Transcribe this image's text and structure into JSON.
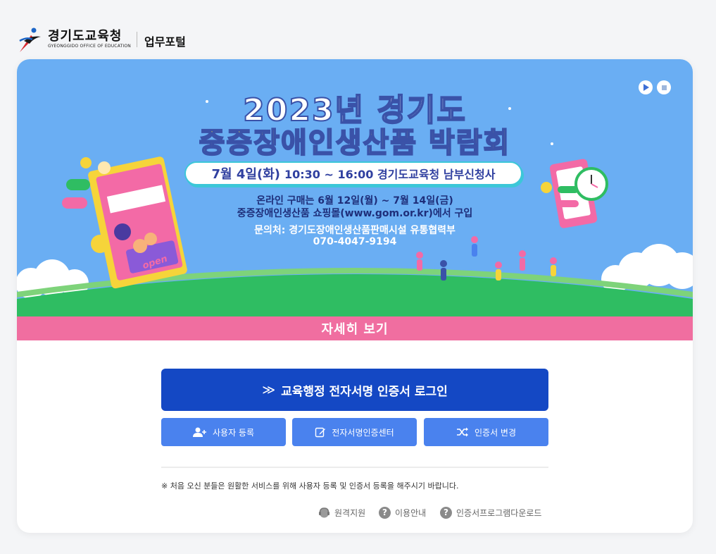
{
  "header": {
    "org_name": "경기도교육청",
    "org_name_en": "GYEONGGIDO OFFICE OF EDUCATION",
    "portal_label": "업무포털"
  },
  "banner": {
    "title_line1": "2023년 경기도",
    "title_line2": "중증장애인생산품 박람회",
    "date_text": "7월 4일(화)",
    "time_place": "10:30 ~ 16:00  경기도교육청 남부신청사",
    "info1": "온라인 구매는 6월 12일(월) ~ 7월 14일(금)",
    "info2": "중증장애인생산품 쇼핑몰(www.gom.or.kr)에서 구입",
    "info3": "문의처: 경기도장애인생산품판매시설 유통협력부",
    "info4": "070-4047-9194",
    "open_sign": "open",
    "detail_label": "자세히 보기",
    "colors": {
      "sky": "#6aaef3",
      "grass": "#2fbd62",
      "pink": "#f06ea0",
      "title_yellow": "#f7e93f"
    }
  },
  "login": {
    "main_chevron": "≫",
    "main_label": "교육행정 전자서명 인증서 로그인",
    "buttons": [
      {
        "label": "사용자 등록",
        "icon": "user-add-icon"
      },
      {
        "label": "전자서명인증센터",
        "icon": "edit-icon"
      },
      {
        "label": "인증서 변경",
        "icon": "shuffle-icon"
      }
    ],
    "notice": "※ 처음 오신 분들은 원활한 서비스를 위해 사용자 등록 및 인증서 등록을 해주시기 바랍니다.",
    "help_links": [
      {
        "label": "원격지원",
        "icon": "headset-icon"
      },
      {
        "label": "이용안내",
        "icon": "question-icon"
      },
      {
        "label": "인증서프로그램다운로드",
        "icon": "question-icon"
      }
    ],
    "question_glyph": "?",
    "colors": {
      "primary": "#1448c4",
      "secondary": "#4a82ee"
    }
  }
}
